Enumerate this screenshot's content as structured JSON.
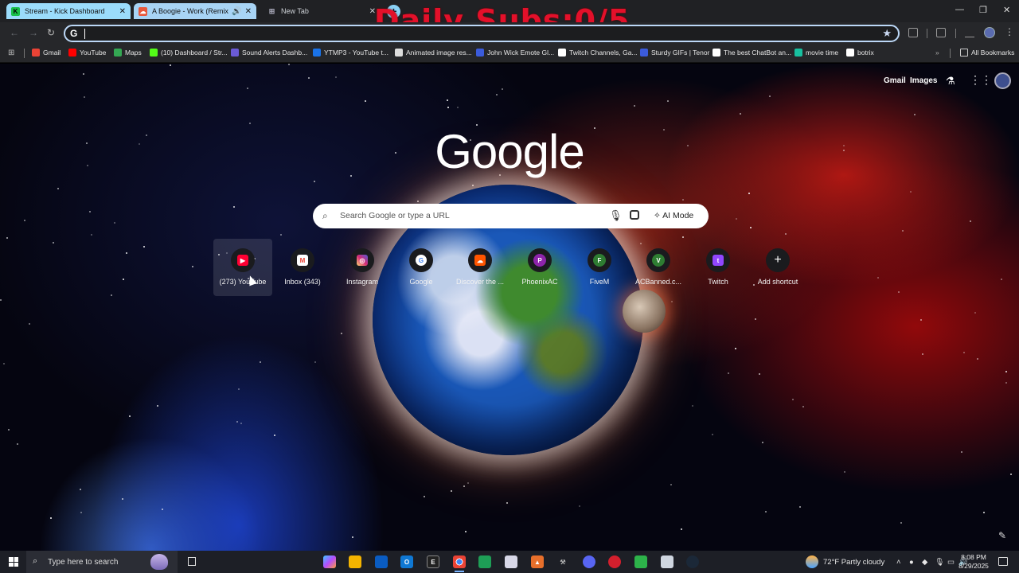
{
  "overlay_text": "Daily Subs:0/5",
  "tabs": [
    {
      "title": "Stream - Kick Dashboard",
      "favicon": "K"
    },
    {
      "title": "A Boogie - Work (Remix) b",
      "favicon": "SC"
    },
    {
      "title": "New Tab",
      "favicon": "⊞"
    }
  ],
  "omnibox": {
    "value": "",
    "icon": "G"
  },
  "bookmarks": [
    {
      "label": "Gmail",
      "color": "#ea4335"
    },
    {
      "label": "YouTube",
      "color": "#ff0000"
    },
    {
      "label": "Maps",
      "color": "#34a853"
    },
    {
      "label": "(10) Dashboard / Str...",
      "color": "#53fc18"
    },
    {
      "label": "Sound Alerts Dashb...",
      "color": "#6b5bd6"
    },
    {
      "label": "YTMP3 - YouTube t...",
      "color": "#1a73e8"
    },
    {
      "label": "Animated image res...",
      "color": "#dddddd"
    },
    {
      "label": "John Wick Emote Gl...",
      "color": "#3b5bdb"
    },
    {
      "label": "Twitch Channels, Ga...",
      "color": "#ffffff"
    },
    {
      "label": "Sturdy GIFs | Tenor",
      "color": "#3b5bdb"
    },
    {
      "label": "The best ChatBot an...",
      "color": "#ffffff"
    },
    {
      "label": "movie time",
      "color": "#18c0a0"
    },
    {
      "label": "botrix",
      "color": "#ffffff"
    }
  ],
  "all_bookmarks": "All Bookmarks",
  "header_links": {
    "gmail": "Gmail",
    "images": "Images"
  },
  "logo": "Google",
  "search": {
    "placeholder": "Search Google or type a URL",
    "ai_mode": "AI Mode"
  },
  "shortcuts": [
    {
      "label": "(273) YouTube",
      "icon": "youtube-icon",
      "glyph": "▶",
      "color": "#ff0033"
    },
    {
      "label": "Inbox (343)",
      "icon": "gmail-icon",
      "glyph": "M",
      "color": "#ea4335"
    },
    {
      "label": "Instagram",
      "icon": "instagram-icon",
      "glyph": "◎",
      "color": "#d62976"
    },
    {
      "label": "Google",
      "icon": "google-icon",
      "glyph": "G",
      "color": "#ffffff"
    },
    {
      "label": "Discover the ...",
      "icon": "soundcloud-icon",
      "glyph": "☁",
      "color": "#ff5500"
    },
    {
      "label": "PhoenixAC",
      "icon": "letter-p-icon",
      "glyph": "P",
      "color": "#8e24aa"
    },
    {
      "label": "FiveM",
      "icon": "letter-f-icon",
      "glyph": "F",
      "color": "#2e7d32"
    },
    {
      "label": "ACBanned.c...",
      "icon": "letter-v-icon",
      "glyph": "V",
      "color": "#2e7d32"
    },
    {
      "label": "Twitch",
      "icon": "twitch-icon",
      "glyph": "t",
      "color": "#9146ff"
    },
    {
      "label": "Add shortcut",
      "icon": "plus-icon",
      "glyph": "+",
      "color": "#ffffff"
    }
  ],
  "taskbar": {
    "search_placeholder": "Type here to search",
    "weather": "72°F  Partly cloudy",
    "time": "8:08 PM",
    "date": "8/29/2025"
  }
}
